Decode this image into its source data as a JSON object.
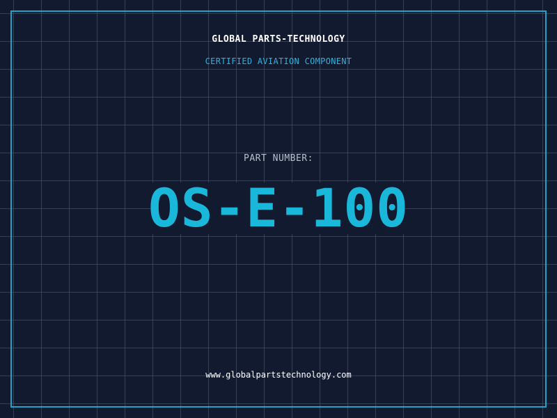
{
  "header": {
    "company_name": "GLOBAL PARTS-TECHNOLOGY",
    "subtitle": "CERTIFIED AVIATION COMPONENT"
  },
  "part": {
    "label": "PART NUMBER:",
    "number": "OS-E-100"
  },
  "footer": {
    "website": "www.globalpartstechnology.com"
  },
  "colors": {
    "background": "#121a30",
    "grid": "#286e8c",
    "frame": "#1fa3c9",
    "accent": "#19b8db",
    "label": "#b8c0cc",
    "text": "#ffffff"
  }
}
